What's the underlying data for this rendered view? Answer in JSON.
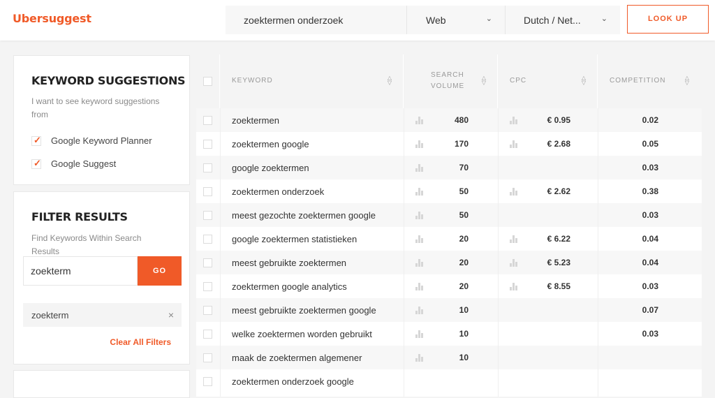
{
  "app": {
    "logo": "Ubersuggest"
  },
  "search": {
    "query": "zoektermen onderzoek",
    "source": "Web",
    "language": "Dutch / Net...",
    "lookup_label": "LOOK UP"
  },
  "keyword_panel": {
    "title": "KEYWORD SUGGESTIONS",
    "description": "I want to see keyword suggestions from",
    "options": [
      {
        "label": "Google Keyword Planner",
        "checked": true
      },
      {
        "label": "Google Suggest",
        "checked": true
      }
    ]
  },
  "filter_panel": {
    "title": "FILTER RESULTS",
    "description": "Find Keywords Within Search Results",
    "input_value": "zoekterm",
    "go_label": "GO",
    "active_filter": "zoekterm",
    "remove_icon": "×",
    "clear_label": "Clear All Filters"
  },
  "table": {
    "headers": {
      "keyword": "KEYWORD",
      "volume_1": "SEARCH",
      "volume_2": "VOLUME",
      "cpc": "CPC",
      "competition": "COMPETITION"
    },
    "rows": [
      {
        "keyword": "zoektermen",
        "volume": "480",
        "cpc": "€ 0.95",
        "competition": "0.02"
      },
      {
        "keyword": "zoektermen google",
        "volume": "170",
        "cpc": "€ 2.68",
        "competition": "0.05"
      },
      {
        "keyword": "google zoektermen",
        "volume": "70",
        "cpc": "",
        "competition": "0.03"
      },
      {
        "keyword": "zoektermen onderzoek",
        "volume": "50",
        "cpc": "€ 2.62",
        "competition": "0.38"
      },
      {
        "keyword": "meest gezochte zoektermen google",
        "volume": "50",
        "cpc": "",
        "competition": "0.03"
      },
      {
        "keyword": "google zoektermen statistieken",
        "volume": "20",
        "cpc": "€ 6.22",
        "competition": "0.04"
      },
      {
        "keyword": "meest gebruikte zoektermen",
        "volume": "20",
        "cpc": "€ 5.23",
        "competition": "0.04"
      },
      {
        "keyword": "zoektermen google analytics",
        "volume": "20",
        "cpc": "€ 8.55",
        "competition": "0.03"
      },
      {
        "keyword": "meest gebruikte zoektermen google",
        "volume": "10",
        "cpc": "",
        "competition": "0.07"
      },
      {
        "keyword": "welke zoektermen worden gebruikt",
        "volume": "10",
        "cpc": "",
        "competition": "0.03"
      },
      {
        "keyword": "maak de zoektermen algemener",
        "volume": "10",
        "cpc": "",
        "competition": ""
      },
      {
        "keyword": "zoektermen onderzoek google",
        "volume": "",
        "cpc": "",
        "competition": ""
      }
    ]
  },
  "colors": {
    "brand": "#f05a28",
    "row_alt": "#f7f7f7",
    "header_bg": "#f4f4f4"
  }
}
